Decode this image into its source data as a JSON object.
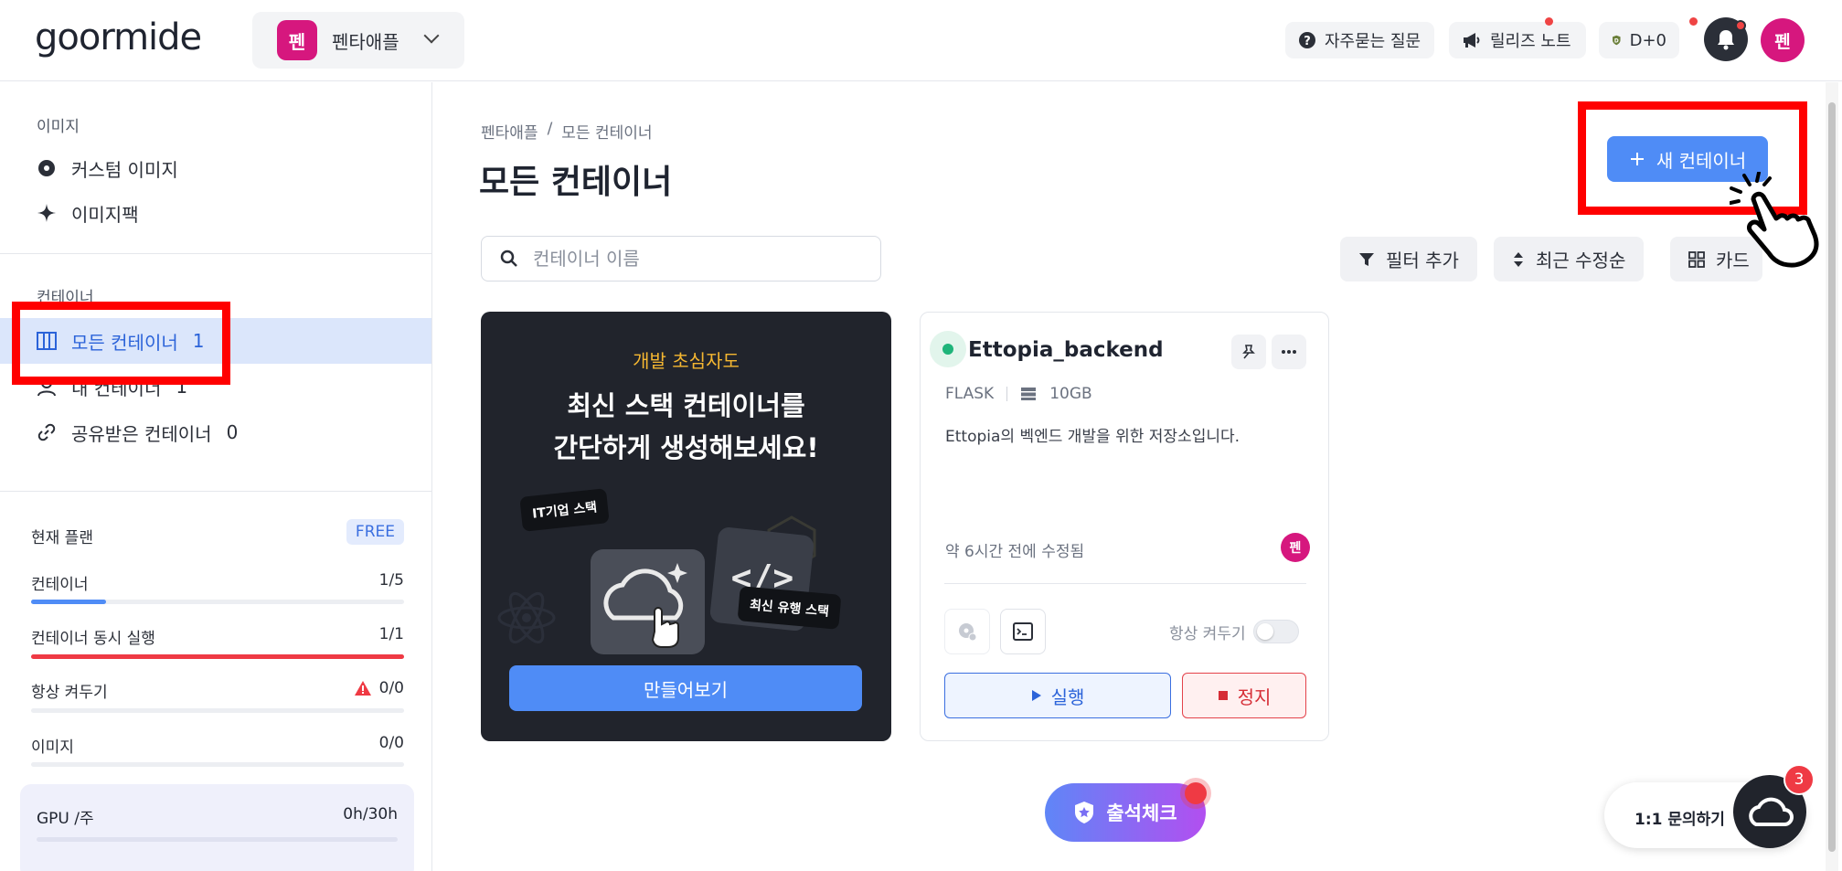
{
  "header": {
    "logo": "goormide",
    "project": {
      "badge": "펜",
      "name": "펜타애플"
    },
    "faq_label": "자주묻는 질문",
    "release_notes_label": "릴리즈 노트",
    "dday_label": "D+0",
    "avatar": "펜"
  },
  "colors": {
    "brand_pink": "#d6177e",
    "accent_blue": "#4f8cf6",
    "running_green": "#1fb47a",
    "danger_red": "#e4424a",
    "highlight": "#ff0000"
  },
  "sidebar": {
    "image_section": "이미지",
    "image_items": [
      {
        "label": "커스텀 이미지",
        "icon": "disc-icon"
      },
      {
        "label": "이미지팩",
        "icon": "sparkle-icon"
      }
    ],
    "container_section": "컨테이너",
    "container_items": [
      {
        "label": "모든 컨테이너",
        "count": "1",
        "icon": "columns-icon",
        "active": true
      },
      {
        "label": "내 컨테이너",
        "count": "1",
        "icon": "user-icon"
      },
      {
        "label": "공유받은 컨테이너",
        "count": "0",
        "icon": "link-icon"
      }
    ],
    "plan": {
      "title": "현재 플랜",
      "badge": "FREE",
      "rows": [
        {
          "label": "컨테이너",
          "value": "1/5",
          "progress": 0.2,
          "color": "#4f8cf6"
        },
        {
          "label": "컨테이너 동시 실행",
          "value": "1/1",
          "progress": 1.0,
          "color": "#ef3a44"
        },
        {
          "label": "항상 켜두기",
          "value": "0/0",
          "progress": 0,
          "warning": true
        },
        {
          "label": "이미지",
          "value": "0/0",
          "progress": 0
        }
      ],
      "gpu": {
        "label": "GPU /주",
        "value": "0h/30h",
        "progress": 0
      }
    }
  },
  "main": {
    "breadcrumb": [
      "펜타애플",
      "/",
      "모든 컨테이너"
    ],
    "title": "모든 컨테이너",
    "new_button": "새 컨테이너",
    "search_placeholder": "컨테이너 이름",
    "filter_label": "필터 추가",
    "sort_label": "최근 수정순",
    "view_label": "카드"
  },
  "promo": {
    "tag": "개발 초심자도",
    "title_line1": "최신 스택 컨테이너를",
    "title_line2": "간단하게 생성해보세요!",
    "bubble_1": "IT기업 스택",
    "bubble_2": "최신 유행 스택",
    "button": "만들어보기"
  },
  "container_card": {
    "name": "Ettopia_backend",
    "stack": "FLASK",
    "storage": "10GB",
    "description": "Ettopia의 벡엔드 개발을 위한 저장소입니다.",
    "edited": "약 6시간 전에 수정됨",
    "owner_avatar": "펜",
    "always_on_label": "항상 켜두기",
    "run_label": "실행",
    "stop_label": "정지"
  },
  "floating": {
    "attendance_label": "출석체크",
    "help_label": "1:1 문의하기",
    "help_count": "3"
  }
}
